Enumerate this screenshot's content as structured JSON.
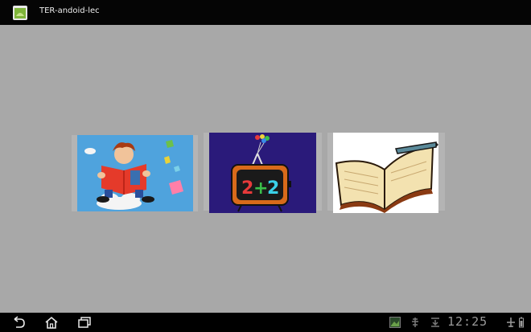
{
  "window": {
    "title": "TER-andoid-lec",
    "app_icon": "android-app-icon"
  },
  "tiles": [
    {
      "name": "reading-tile",
      "icon": "boy-reading-book-image",
      "bg": "#4fa3dd"
    },
    {
      "name": "math-tile",
      "icon": "tv-2plus2-image",
      "bg": "#2a1a7a"
    },
    {
      "name": "writing-tile",
      "icon": "open-book-pen-image",
      "bg": "#ffffff"
    }
  ],
  "navbar": {
    "back_icon": "back-icon",
    "home_icon": "home-icon",
    "recents_icon": "recent-apps-icon",
    "clock": "12:25"
  },
  "colors": {
    "background": "#a8a8a8",
    "titlebar": "#050505",
    "navbar": "#000000"
  }
}
